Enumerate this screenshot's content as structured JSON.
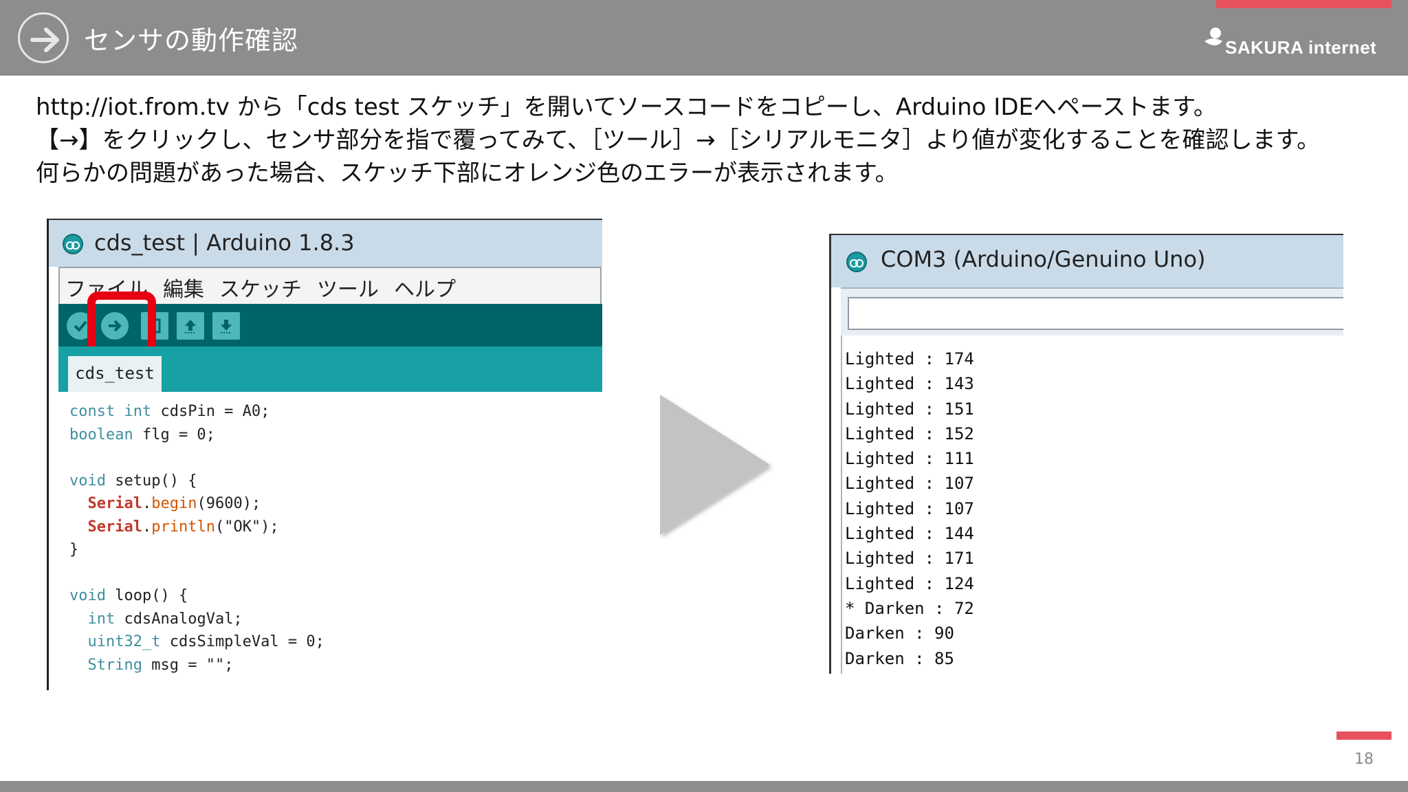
{
  "header": {
    "title": "センサの動作確認",
    "logo_text": "SAKURA internet",
    "accent_color": "#e8525f",
    "bar_color": "#8d8d8d"
  },
  "instructions": [
    "http://iot.from.tv から「cds test スケッチ」を開いてソースコードをコピーし、Arduino IDEへペーストます。",
    "【→】をクリックし、センサ部分を指で覆ってみて、［ツール］→［シリアルモニタ］より値が変化することを確認します。",
    "何らかの問題があった場合、スケッチ下部にオレンジ色のエラーが表示されます。"
  ],
  "ide": {
    "title": "cds_test | Arduino 1.8.3",
    "menu": [
      "ファイル",
      "編集",
      "スケッチ",
      "ツール",
      "ヘルプ"
    ],
    "toolbar": [
      "verify-icon",
      "upload-icon",
      "new-icon",
      "open-icon",
      "save-icon"
    ],
    "tab": "cds_test",
    "code": {
      "l1_kw": "const int",
      "l1_rest": " cdsPin = A0;",
      "l2_kw": "boolean",
      "l2_rest": " flg = 0;",
      "l4_kw": "void",
      "l4_rest": " setup() {",
      "l5_cls": "Serial",
      "l5_dot": ".",
      "l5_fn": "begin",
      "l5_rest": "(9600);",
      "l6_cls": "Serial",
      "l6_dot": ".",
      "l6_fn": "println",
      "l6_rest": "(\"OK\");",
      "l7": "}",
      "l9_kw": "void",
      "l9_rest": " loop() {",
      "l10_kw": "int",
      "l10_rest": " cdsAnalogVal;",
      "l11_kw": "uint32_t",
      "l11_rest": " cdsSimpleVal = 0;",
      "l12_kw": "String",
      "l12_rest": " msg = \"\";"
    }
  },
  "serial": {
    "title": "COM3 (Arduino/Genuino Uno)",
    "input_value": "",
    "output": [
      "Lighted : 174",
      "Lighted : 143",
      "Lighted : 151",
      "Lighted : 152",
      "Lighted : 111",
      "Lighted : 107",
      "Lighted : 107",
      "Lighted : 144",
      "Lighted : 171",
      "Lighted : 124",
      "* Darken : 72",
      "Darken : 90",
      "Darken : 85"
    ]
  },
  "page_number": "18"
}
